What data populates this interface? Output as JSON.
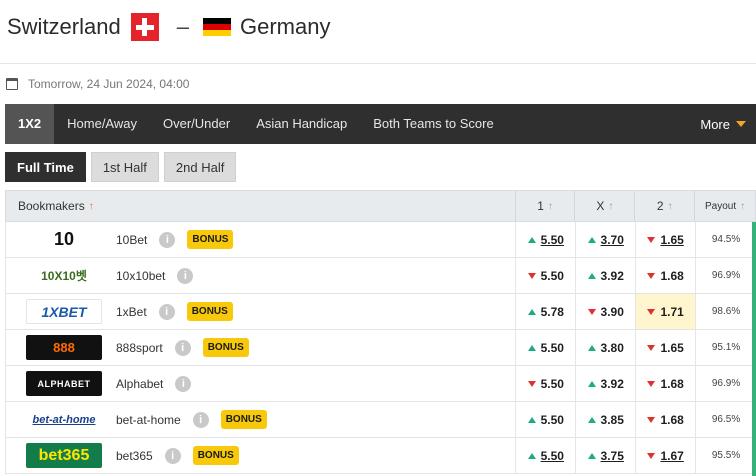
{
  "match": {
    "home_team": "Switzerland",
    "separator": "–",
    "away_team": "Germany",
    "datetime": "Tomorrow, 24 Jun 2024, 04:00"
  },
  "colors": {
    "swiss_red": "#e4232b",
    "german_flag": [
      "#000000",
      "#dd0000",
      "#ffce00"
    ],
    "accent_orange": "#f4a623",
    "bonus_yellow": "#f7c90a",
    "up_green": "#1faa87",
    "down_red": "#e03030"
  },
  "market_tabs": [
    {
      "label": "1X2",
      "active": true
    },
    {
      "label": "Home/Away",
      "active": false
    },
    {
      "label": "Over/Under",
      "active": false
    },
    {
      "label": "Asian Handicap",
      "active": false
    },
    {
      "label": "Both Teams to Score",
      "active": false
    }
  ],
  "more_label": "More",
  "period_tabs": [
    {
      "label": "Full Time",
      "active": true
    },
    {
      "label": "1st Half",
      "active": false
    },
    {
      "label": "2nd Half",
      "active": false
    }
  ],
  "table": {
    "headers": {
      "bookmakers": "Bookmakers",
      "home": "1",
      "draw": "X",
      "away": "2",
      "payout": "Payout"
    },
    "rows": [
      {
        "logo": "10",
        "name": "10Bet",
        "bonus": "BONUS",
        "odds": [
          {
            "v": "5.50",
            "dir": "up",
            "link": true
          },
          {
            "v": "3.70",
            "dir": "up",
            "link": true
          },
          {
            "v": "1.65",
            "dir": "down",
            "link": true
          }
        ],
        "payout": "94.5%"
      },
      {
        "logo": "10X10벳",
        "name": "10x10bet",
        "bonus": "",
        "odds": [
          {
            "v": "5.50",
            "dir": "down",
            "link": false
          },
          {
            "v": "3.92",
            "dir": "up",
            "link": false
          },
          {
            "v": "1.68",
            "dir": "down",
            "link": false
          }
        ],
        "payout": "96.9%"
      },
      {
        "logo": "1XBET",
        "name": "1xBet",
        "bonus": "BONUS",
        "odds": [
          {
            "v": "5.78",
            "dir": "up",
            "link": false
          },
          {
            "v": "3.90",
            "dir": "down",
            "link": false
          },
          {
            "v": "1.71",
            "dir": "down",
            "link": false,
            "hl": true
          }
        ],
        "payout": "98.6%"
      },
      {
        "logo": "888",
        "name": "888sport",
        "bonus": "BONUS",
        "odds": [
          {
            "v": "5.50",
            "dir": "up",
            "link": false
          },
          {
            "v": "3.80",
            "dir": "up",
            "link": false
          },
          {
            "v": "1.65",
            "dir": "down",
            "link": false
          }
        ],
        "payout": "95.1%"
      },
      {
        "logo": "ALPHABET",
        "name": "Alphabet",
        "bonus": "",
        "odds": [
          {
            "v": "5.50",
            "dir": "down",
            "link": false
          },
          {
            "v": "3.92",
            "dir": "up",
            "link": false
          },
          {
            "v": "1.68",
            "dir": "down",
            "link": false
          }
        ],
        "payout": "96.9%"
      },
      {
        "logo": "bet-at-home",
        "name": "bet-at-home",
        "bonus": "BONUS",
        "odds": [
          {
            "v": "5.50",
            "dir": "up",
            "link": false
          },
          {
            "v": "3.85",
            "dir": "up",
            "link": false
          },
          {
            "v": "1.68",
            "dir": "down",
            "link": false
          }
        ],
        "payout": "96.5%"
      },
      {
        "logo": "bet365",
        "name": "bet365",
        "bonus": "BONUS",
        "odds": [
          {
            "v": "5.50",
            "dir": "up",
            "link": true
          },
          {
            "v": "3.75",
            "dir": "up",
            "link": true
          },
          {
            "v": "1.67",
            "dir": "down",
            "link": true
          }
        ],
        "payout": "95.5%"
      }
    ]
  }
}
